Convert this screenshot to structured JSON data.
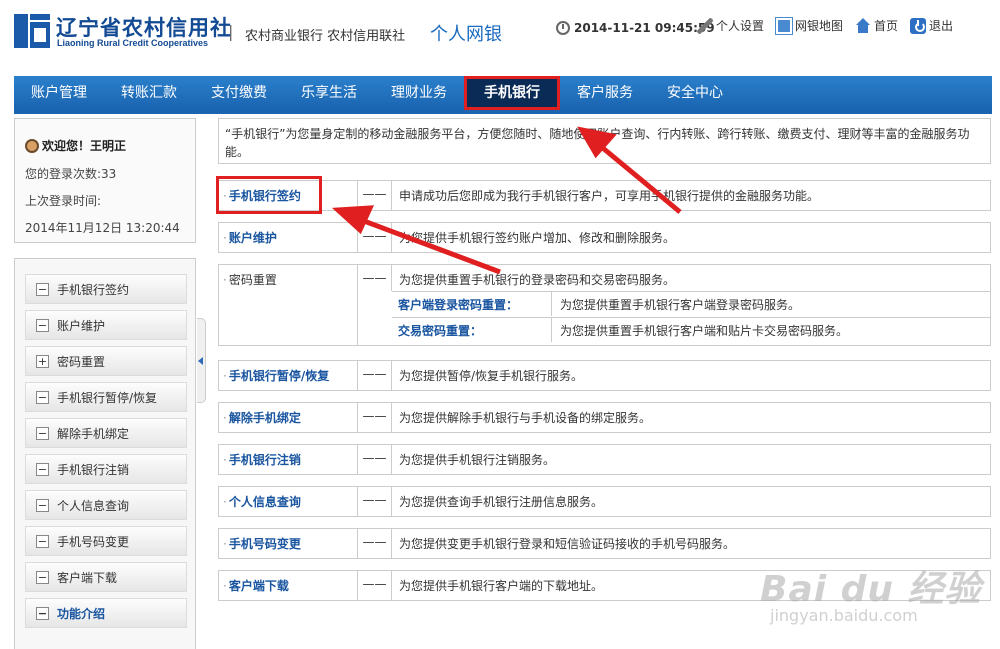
{
  "header": {
    "brand_cn": "辽宁省农村信用社",
    "brand_en": "Liaoning Rural Credit Cooperatives",
    "separator": "|",
    "subtitle": "农村商业银行  农村信用联社",
    "personal": "个人网银",
    "datetime": "2014-11-21 09:45:59",
    "links": {
      "settings": "个人设置",
      "sitemap": "网银地图",
      "home": "首页",
      "logout": "退出"
    }
  },
  "nav": {
    "account": "账户管理",
    "transfer": "转账汇款",
    "payment": "支付缴费",
    "life": "乐享生活",
    "finance": "理财业务",
    "mobile": "手机银行",
    "service": "客户服务",
    "security": "安全中心"
  },
  "user": {
    "welcome": "欢迎您！王明正",
    "login_count": "您的登录次数:33",
    "last_login_label": "上次登录时间:",
    "last_login_time": "2014年11月12日  13:20:44"
  },
  "menu": [
    {
      "sign": "−",
      "label": "手机银行签约"
    },
    {
      "sign": "−",
      "label": "账户维护"
    },
    {
      "sign": "+",
      "label": "密码重置"
    },
    {
      "sign": "−",
      "label": "手机银行暂停/恢复"
    },
    {
      "sign": "−",
      "label": "解除手机绑定"
    },
    {
      "sign": "−",
      "label": "手机银行注销"
    },
    {
      "sign": "−",
      "label": "个人信息查询"
    },
    {
      "sign": "−",
      "label": "手机号码变更"
    },
    {
      "sign": "−",
      "label": "客户端下载"
    },
    {
      "sign": "−",
      "label": "功能介绍"
    }
  ],
  "intro": "“手机银行”为您量身定制的移动金融服务平台，方便您随时、随地使用账户查询、行内转账、跨行转账、缴费支付、理财等丰富的金融服务功能。",
  "dash": "——",
  "dot": "·",
  "services": [
    {
      "name": "手机银行签约",
      "desc": "申请成功后您即成为我行手机银行客户，可享用手机银行提供的金融服务功能。"
    },
    {
      "name": "账户维护",
      "desc": "为您提供手机银行签约账户增加、修改和删除服务。"
    },
    {
      "name": "密码重置",
      "desc": "为您提供重置手机银行的登录密码和交易密码服务。",
      "subs": [
        {
          "name": "客户端登录密码重置：",
          "desc": "为您提供重置手机银行客户端登录密码服务。"
        },
        {
          "name": "交易密码重置：",
          "desc": "为您提供重置手机银行客户端和贴片卡交易密码服务。"
        }
      ]
    },
    {
      "name": "手机银行暂停/恢复",
      "desc": "为您提供暂停/恢复手机银行服务。"
    },
    {
      "name": "解除手机绑定",
      "desc": "为您提供解除手机银行与手机设备的绑定服务。"
    },
    {
      "name": "手机银行注销",
      "desc": "为您提供手机银行注销服务。"
    },
    {
      "name": "个人信息查询",
      "desc": "为您提供查询手机银行注册信息服务。"
    },
    {
      "name": "手机号码变更",
      "desc": "为您提供变更手机银行登录和短信验证码接收的手机号码服务。"
    },
    {
      "name": "客户端下载",
      "desc": "为您提供手机银行客户端的下载地址。"
    }
  ],
  "watermark": {
    "main": "Bai du 经验",
    "sub": "jingyan.baidu.com"
  }
}
